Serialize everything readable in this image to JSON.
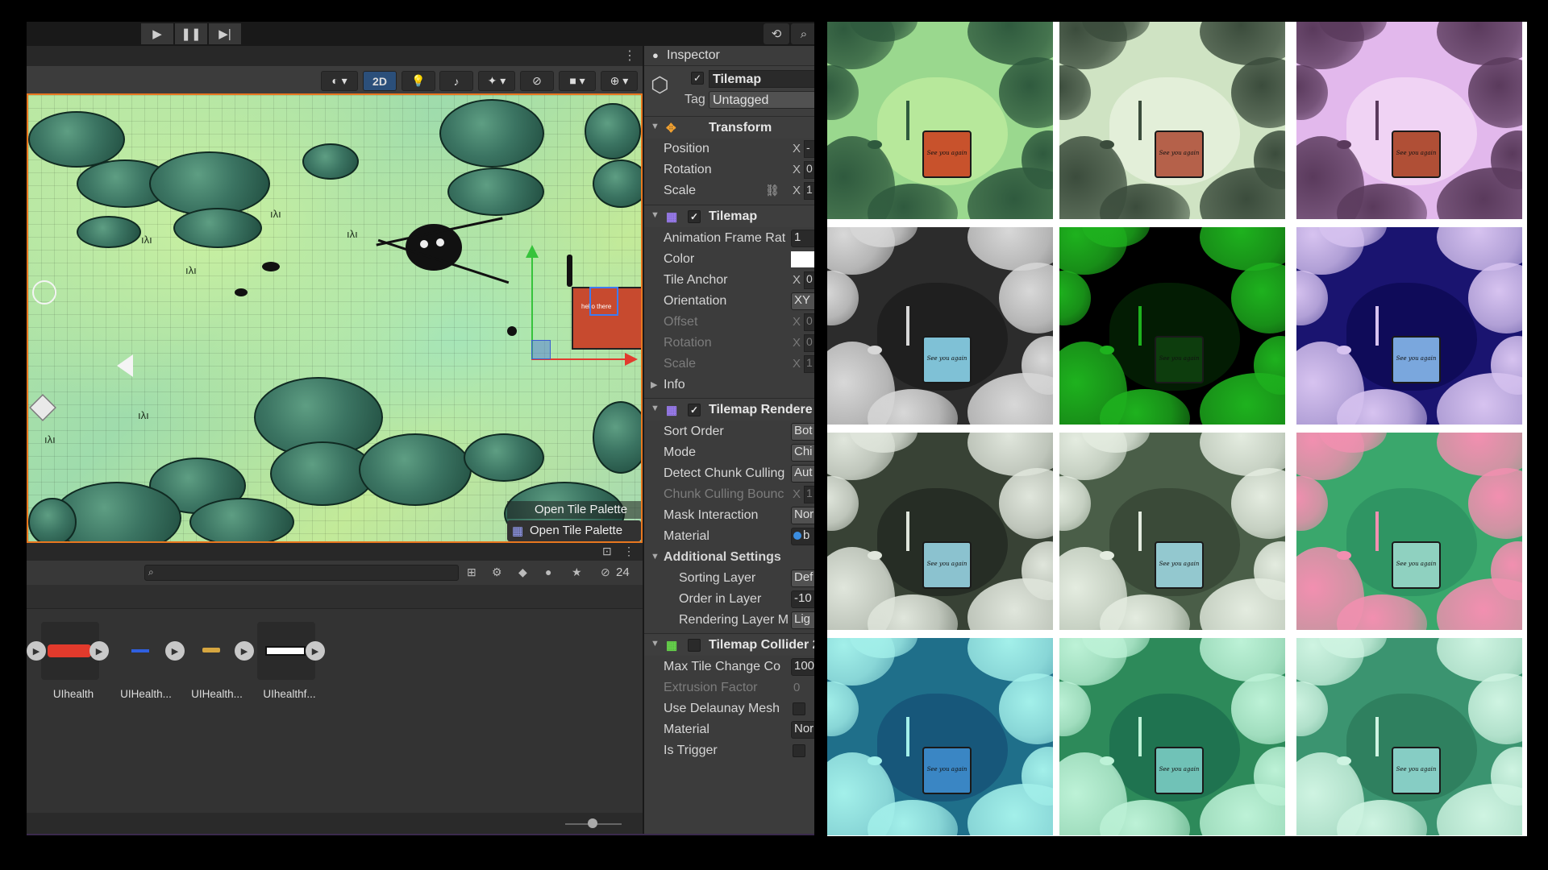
{
  "editor": {
    "toolbar": {
      "play_icon": "play-icon",
      "pause_icon": "pause-icon",
      "step_icon": "step-icon",
      "history_icon": "history-icon",
      "search_icon": "search-icon"
    },
    "scene": {
      "toggle_2d": "2D",
      "overlay_button_1": "Open Tile Palette",
      "overlay_button_2": "Open Tile Palette",
      "sign_text": "hello there"
    },
    "project": {
      "hidden_count": "24",
      "assets": [
        {
          "label": "UIhealth",
          "color": "#e23a2c"
        },
        {
          "label": "UIHealth...",
          "color": "#2f5fe0"
        },
        {
          "label": "UIHealth...",
          "color": "#d6a640"
        },
        {
          "label": "UIhealthf...",
          "color": "#ffffff"
        }
      ]
    },
    "inspector": {
      "tab_title": "Inspector",
      "object_name": "Tilemap",
      "tag_label": "Tag",
      "tag_value": "Untagged",
      "transform": {
        "title": "Transform",
        "position": "Position",
        "rotation": "Rotation",
        "scale": "Scale",
        "x": "X",
        "position_x": "-",
        "rotation_x": "0",
        "scale_x": "1"
      },
      "tilemap": {
        "title": "Tilemap",
        "animation_frame_rate": "Animation Frame Rat",
        "animation_frame_rate_value": "1",
        "color": "Color",
        "tile_anchor": "Tile Anchor",
        "tile_anchor_x": "X",
        "tile_anchor_value": "0",
        "orientation": "Orientation",
        "orientation_value": "XY",
        "offset": "Offset",
        "offset_x": "X",
        "offset_value": "0",
        "rotation": "Rotation",
        "rotation_x": "X",
        "rotation_value": "0",
        "scale": "Scale",
        "scale_x": "X",
        "scale_value": "1",
        "info": "Info"
      },
      "renderer": {
        "title": "Tilemap Rendere",
        "sort_order": "Sort Order",
        "sort_order_value": "Bot",
        "mode": "Mode",
        "mode_value": "Chi",
        "detect_chunk": "Detect Chunk Culling",
        "detect_chunk_value": "Aut",
        "chunk_bounds": "Chunk Culling Bounc",
        "chunk_bounds_x": "X",
        "chunk_bounds_value": "1",
        "mask_interaction": "Mask Interaction",
        "mask_interaction_value": "Nor",
        "material": "Material",
        "material_value": "b",
        "additional": "Additional Settings",
        "sorting_layer": "Sorting Layer",
        "sorting_layer_value": "Def",
        "order_in_layer": "Order in Layer",
        "order_in_layer_value": "-10",
        "rendering_layer": "Rendering Layer M",
        "rendering_layer_value": "Lig"
      },
      "collider": {
        "title": "Tilemap Collider 2",
        "max_tile_change": "Max Tile Change Co",
        "max_tile_change_value": "100",
        "extrusion_factor": "Extrusion Factor",
        "extrusion_factor_value": "0",
        "use_delaunay": "Use Delaunay Mesh",
        "material": "Material",
        "material_value": "Nor",
        "is_trigger": "Is Trigger"
      }
    }
  },
  "thumbnails": [
    {
      "variant": "original",
      "bg": "#9ad88e",
      "tree": "#2f5a3e",
      "pool": "#b7e89b",
      "sign": "#c8522c",
      "sign_text": "See you again"
    },
    {
      "variant": "desaturated-light",
      "bg": "#cfe3c3",
      "tree": "#3b4c3c",
      "pool": "#e3efd9",
      "sign": "#b5614a",
      "sign_text": "See you again"
    },
    {
      "variant": "purple-tint",
      "bg": "#e2b8ec",
      "tree": "#5a3a5c",
      "pool": "#f0d3f4",
      "sign": "#b04f36",
      "sign_text": "See you again"
    },
    {
      "variant": "inverted-gray",
      "bg": "#2c2c2c",
      "tree": "#d8d8d8",
      "pool": "#1f1f1f",
      "sign": "#7fc1d6",
      "sign_text": "See you again"
    },
    {
      "variant": "green-neon",
      "bg": "#000000",
      "tree": "#1eb21e",
      "pool": "#031c03",
      "sign": "#0d3d0d",
      "sign_text": "See you again"
    },
    {
      "variant": "inverted-violet",
      "bg": "#1a1470",
      "tree": "#d7c3f0",
      "pool": "#0f0b59",
      "sign": "#7aa7dd",
      "sign_text": "See you again"
    },
    {
      "variant": "inverted-dark-green",
      "bg": "#384235",
      "tree": "#e0e6dc",
      "pool": "#262d25",
      "sign": "#8bc2cf",
      "sign_text": "See you again"
    },
    {
      "variant": "inverted-moss",
      "bg": "#4a5e48",
      "tree": "#e4ece0",
      "pool": "#3a4a38",
      "sign": "#93c8cf",
      "sign_text": "See you again"
    },
    {
      "variant": "pink-green",
      "bg": "#3aa76c",
      "tree": "#f28fb0",
      "pool": "#2f9563",
      "sign": "#8fd1c0",
      "sign_text": "See you again"
    },
    {
      "variant": "teal-cyan",
      "bg": "#1f6f8a",
      "tree": "#a3f0ea",
      "pool": "#17577a",
      "sign": "#3a86c4",
      "sign_text": "See you again"
    },
    {
      "variant": "green-teal",
      "bg": "#2d8a5a",
      "tree": "#bdf2d7",
      "pool": "#1f7350",
      "sign": "#70c2b7",
      "sign_text": "See you again"
    },
    {
      "variant": "sea-green",
      "bg": "#3b9470",
      "tree": "#cff4e2",
      "pool": "#2f805f",
      "sign": "#86cdc4",
      "sign_text": "See you again"
    }
  ]
}
